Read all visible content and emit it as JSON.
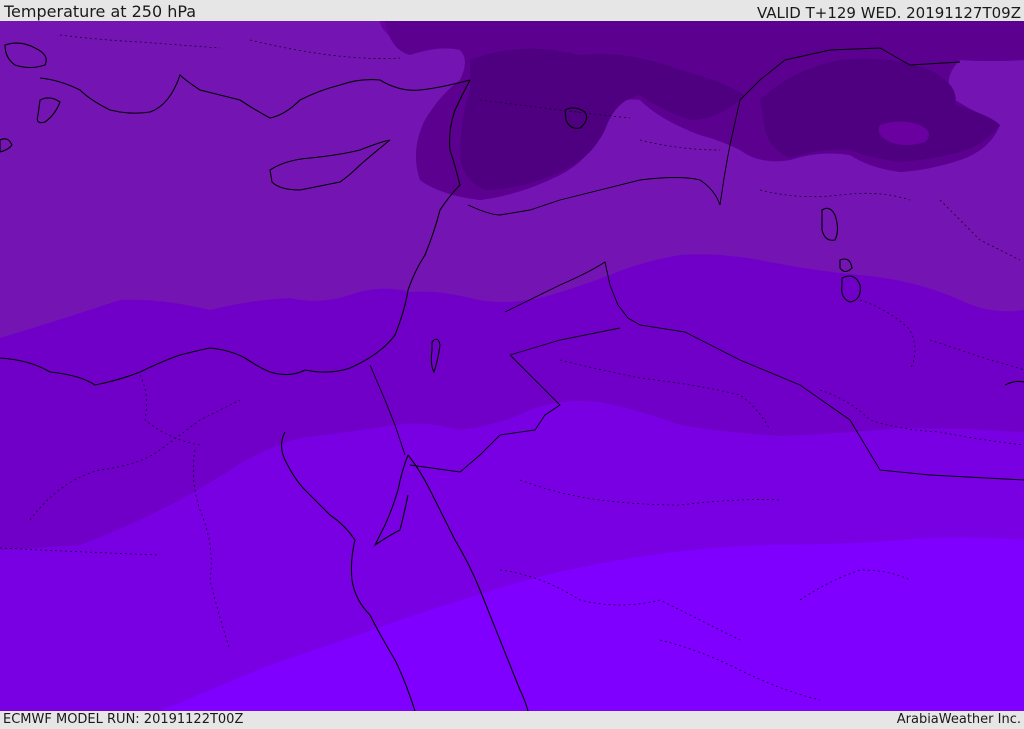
{
  "header": {
    "title": "Temperature at 250 hPa",
    "valid": "VALID T+129 WED. 20191127T09Z"
  },
  "footer": {
    "model_run": "ECMWF MODEL RUN: 20191122T00Z",
    "credit": "ArabiaWeather Inc."
  },
  "colors": {
    "band_darkest": "#4f0080",
    "band_dark": "#5c0090",
    "band_mid_dark": "#6a00a0",
    "band_mid": "#7414b2",
    "band_mid_light": "#7000c8",
    "band_light": "#7a00e4",
    "band_lightest": "#7f00ff",
    "coastline": "#000000",
    "border": "#000000"
  }
}
